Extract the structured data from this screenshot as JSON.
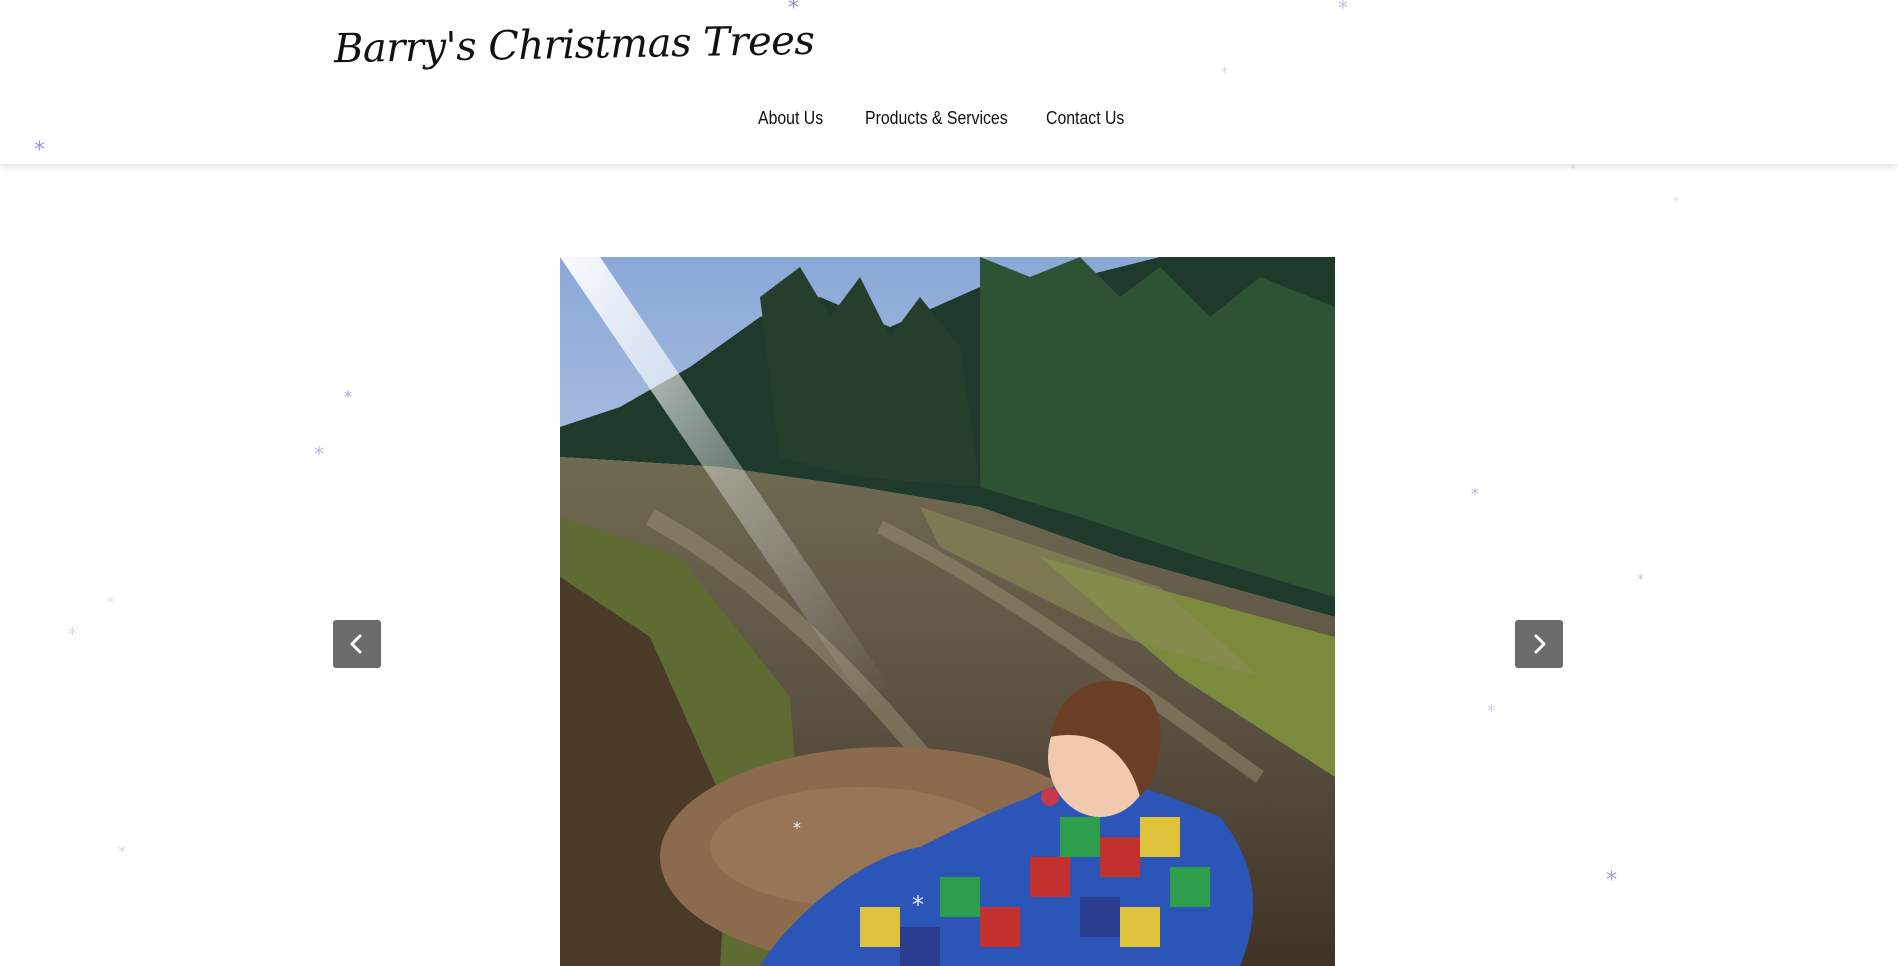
{
  "site": {
    "brand": "Barry's Christmas Trees"
  },
  "nav": {
    "items": [
      {
        "label": "About Us"
      },
      {
        "label": "Products & Services"
      },
      {
        "label": "Contact Us"
      }
    ]
  },
  "slider": {
    "prev_icon": "chevron-left-icon",
    "next_icon": "chevron-right-icon",
    "current_image": "child-in-muddy-track-among-christmas-trees"
  },
  "decor": {
    "snowflake_glyph": "*",
    "snowflake_color": "#7d7fc9"
  },
  "colors": {
    "header_bg": "#ffffff",
    "button_bg": "#6b6b6b",
    "text": "#111111"
  }
}
